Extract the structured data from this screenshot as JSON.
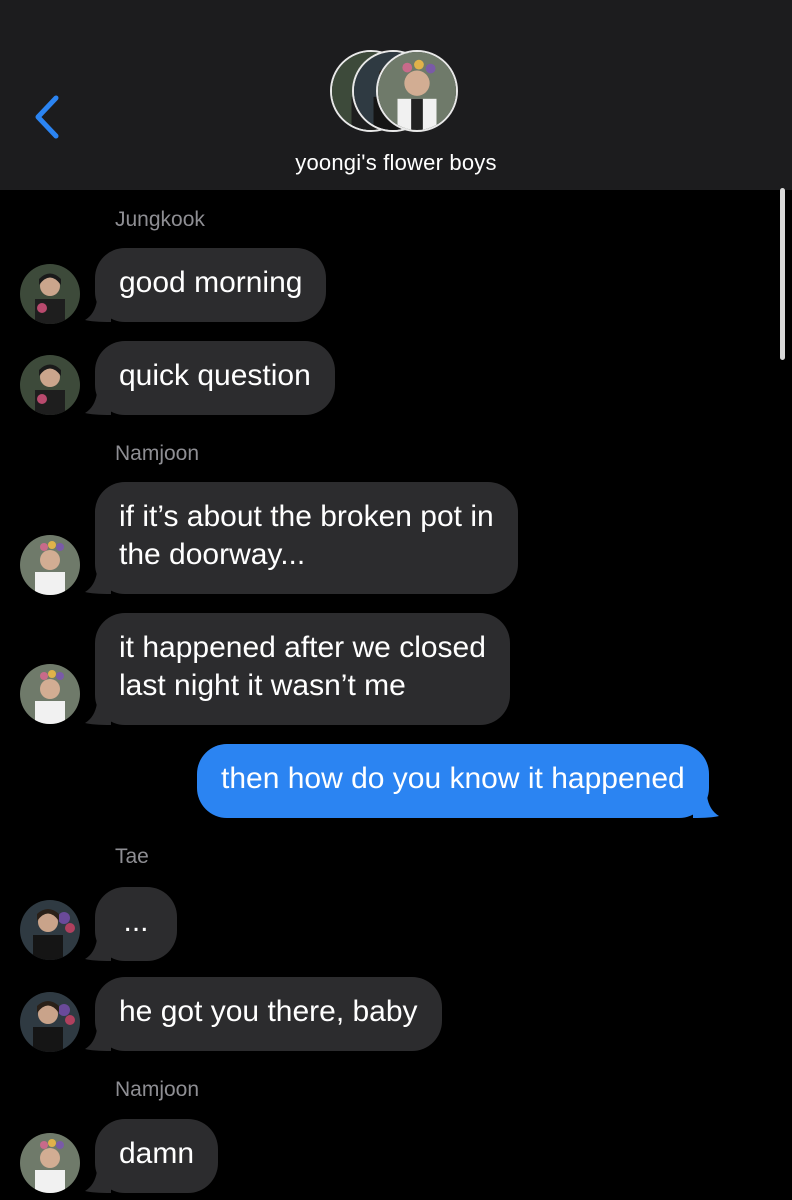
{
  "header": {
    "back_icon": "chevron-left-icon",
    "group_name": "yoongi's flower boys",
    "accent_color": "#2b84f2"
  },
  "messages": [
    {
      "sender": "Jungkook"
    },
    {
      "text": "good morning"
    },
    {
      "text": "quick question"
    },
    {
      "sender": "Namjoon"
    },
    {
      "line1": "if it’s about the broken pot in",
      "line2": "the doorway..."
    },
    {
      "line1": "it happened after we closed",
      "line2": "last night it wasn’t me"
    },
    {
      "text": "then how do you know it happened"
    },
    {
      "sender": "Tae"
    },
    {
      "text": "..."
    },
    {
      "text": "he got you there, baby"
    },
    {
      "sender": "Namjoon"
    },
    {
      "text": "damn"
    }
  ],
  "colors": {
    "incoming_bubble": "#2c2c2e",
    "outgoing_bubble": "#2b84f2",
    "sender_label": "#8e8e93",
    "header_bg": "#1c1c1e"
  }
}
